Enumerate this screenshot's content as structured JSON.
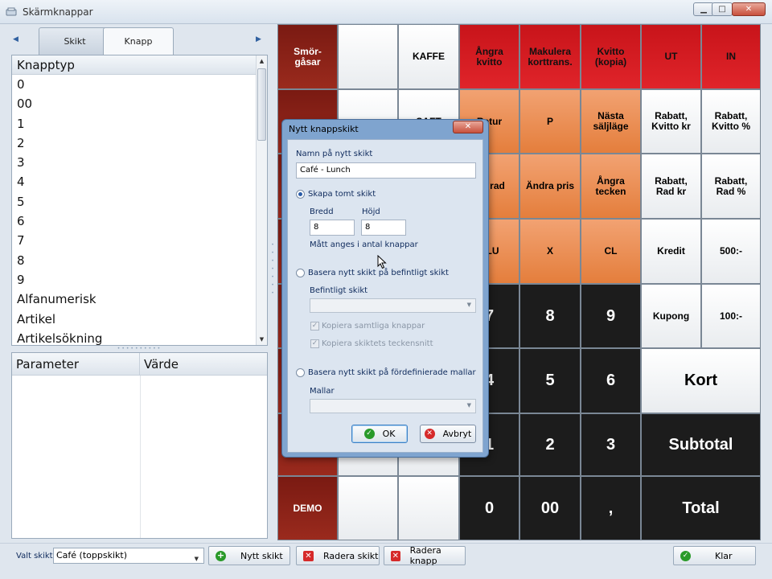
{
  "window": {
    "title": "Skärmknappar",
    "controls": {
      "minimize": "▁",
      "maximize": "□",
      "close": "✕"
    }
  },
  "tabs": [
    {
      "label": "Skikt"
    },
    {
      "label": "Knapp"
    }
  ],
  "button_type_list": {
    "header": "Knapptyp",
    "items": [
      "0",
      "00",
      "1",
      "2",
      "3",
      "4",
      "5",
      "6",
      "7",
      "8",
      "9",
      "Alfanumerisk",
      "Artikel",
      "Artikelsökning"
    ]
  },
  "parameter_grid": {
    "columns": [
      "Parameter",
      "Värde"
    ]
  },
  "keys": {
    "r0": [
      "Smör-\ngåsar",
      "",
      "KAFFE",
      "Ångra\nkvitto",
      "Makulera\nkorttrans.",
      "Kvitto\n(kopia)",
      "UT",
      "IN"
    ],
    "r1": [
      "",
      "",
      "SAFT",
      "Retur",
      "P",
      "Nästa\nsäljläge",
      "Rabatt,\nKvitto kr",
      "Rabatt,\nKvitto %"
    ],
    "r2": [
      "",
      "",
      "",
      "...a rad",
      "Ändra pris",
      "Ångra\ntecken",
      "Rabatt,\nRad kr",
      "Rabatt,\nRad %"
    ],
    "r3": [
      "",
      "",
      "",
      "PLU",
      "X",
      "CL",
      "Kredit",
      "500:-"
    ],
    "r4": [
      "",
      "",
      "",
      "7",
      "8",
      "9",
      "Kupong",
      "100:-"
    ],
    "r5": [
      "",
      "",
      "",
      "4",
      "5",
      "6",
      "Kort"
    ],
    "r6": [
      "",
      "",
      "",
      "1",
      "2",
      "3",
      "Subtotal"
    ],
    "r7": [
      "DEMO",
      "",
      "",
      "0",
      "00",
      ",",
      "Total"
    ]
  },
  "dialog": {
    "title": "Nytt knappskikt",
    "close": "✕",
    "name_label": "Namn på nytt skikt",
    "name_value": "Café - Lunch",
    "option_empty": "Skapa tomt skikt",
    "width_label": "Bredd",
    "width_value": "8",
    "height_label": "Höjd",
    "height_value": "8",
    "size_hint": "Mått anges i antal knappar",
    "option_existing": "Basera nytt skikt på befintligt skikt",
    "existing_label": "Befintligt skikt",
    "copy_buttons": "Kopiera samtliga knappar",
    "copy_font": "Kopiera skiktets teckensnitt",
    "option_template": "Basera nytt skikt på fördefinierade mallar",
    "template_label": "Mallar",
    "ok": "OK",
    "cancel": "Avbryt"
  },
  "bottom_bar": {
    "selected_layer_label": "Valt skikt",
    "selected_layer_value": "Café (toppskikt)",
    "new_layer": "Nytt skikt",
    "delete_layer": "Radera skikt",
    "delete_button": "Radera knapp",
    "done": "Klar"
  },
  "colors": {
    "maroon": "#8b2218",
    "red": "#d41c22",
    "orange": "#ec8f52",
    "black": "#1c1c1c",
    "dialog_frame": "#7fa4cf"
  }
}
